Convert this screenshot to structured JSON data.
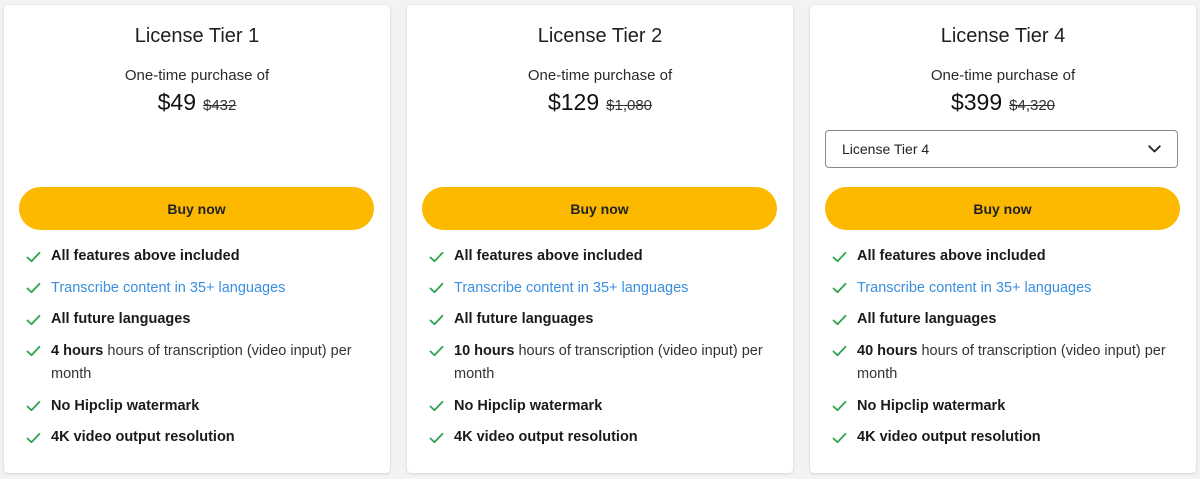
{
  "colors": {
    "buy_button": "#fcb900",
    "check": "#2ea44f",
    "link": "#3a8fe0",
    "card_bg": "#ffffff",
    "page_bg": "#f3f3f3"
  },
  "cards": [
    {
      "title": "License Tier 1",
      "subtitle": "One-time purchase of",
      "price": "$49",
      "old_price": "$432",
      "buy_label": "Buy now",
      "features": {
        "f1": "All features above included",
        "f2": "Transcribe content in 35+ languages",
        "f3": "All future languages",
        "f4_bold": "4 hours",
        "f4_rest": " hours of transcription (video input) per month",
        "f5": "No Hipclip watermark",
        "f6": "4K video output resolution"
      }
    },
    {
      "title": "License Tier 2",
      "subtitle": "One-time purchase of",
      "price": "$129",
      "old_price": "$1,080",
      "buy_label": "Buy now",
      "features": {
        "f1": "All features above included",
        "f2": "Transcribe content in 35+ languages",
        "f3": "All future languages",
        "f4_bold": "10 hours",
        "f4_rest": " hours of transcription (video input) per month",
        "f5": "No Hipclip watermark",
        "f6": "4K video output resolution"
      }
    },
    {
      "title": "License Tier 4",
      "subtitle": "One-time purchase of",
      "price": "$399",
      "old_price": "$4,320",
      "select_value": "License Tier 4",
      "buy_label": "Buy now",
      "features": {
        "f1": "All features above included",
        "f2": "Transcribe content in 35+ languages",
        "f3": "All future languages",
        "f4_bold": "40 hours",
        "f4_rest": " hours of transcription (video input) per month",
        "f5": "No Hipclip watermark",
        "f6": "4K video output resolution"
      }
    }
  ]
}
